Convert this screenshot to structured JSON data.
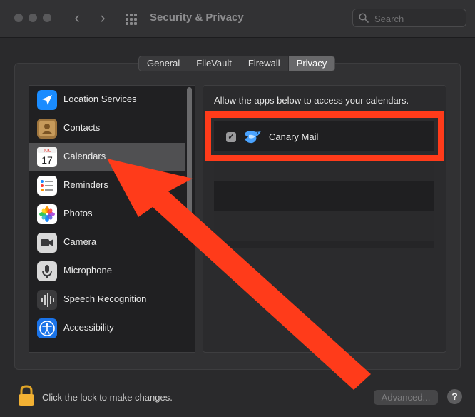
{
  "window": {
    "title": "Security & Privacy",
    "search_placeholder": "Search"
  },
  "tabs": [
    {
      "label": "General",
      "active": false
    },
    {
      "label": "FileVault",
      "active": false
    },
    {
      "label": "Firewall",
      "active": false
    },
    {
      "label": "Privacy",
      "active": true
    }
  ],
  "sidebar": {
    "items": [
      {
        "label": "Location Services",
        "icon": "location-arrow-icon"
      },
      {
        "label": "Contacts",
        "icon": "contacts-book-icon"
      },
      {
        "label": "Calendars",
        "icon": "calendar-icon",
        "selected": true,
        "cal_month": "JUL",
        "cal_day": "17"
      },
      {
        "label": "Reminders",
        "icon": "reminders-list-icon"
      },
      {
        "label": "Photos",
        "icon": "photos-flower-icon"
      },
      {
        "label": "Camera",
        "icon": "camera-icon"
      },
      {
        "label": "Microphone",
        "icon": "microphone-icon"
      },
      {
        "label": "Speech Recognition",
        "icon": "waveform-icon"
      },
      {
        "label": "Accessibility",
        "icon": "accessibility-person-icon"
      }
    ]
  },
  "main": {
    "prompt": "Allow the apps below to access your calendars.",
    "apps": [
      {
        "name": "Canary Mail",
        "checked": true,
        "check_glyph": "✓",
        "icon": "canary-bird-icon"
      }
    ]
  },
  "footer": {
    "lock_text": "Click the lock to make changes.",
    "advanced_label": "Advanced...",
    "help_label": "?"
  },
  "colors": {
    "annotation_red": "#ff3b1a",
    "selected_row": "#505052",
    "active_tab": "#68686a"
  }
}
